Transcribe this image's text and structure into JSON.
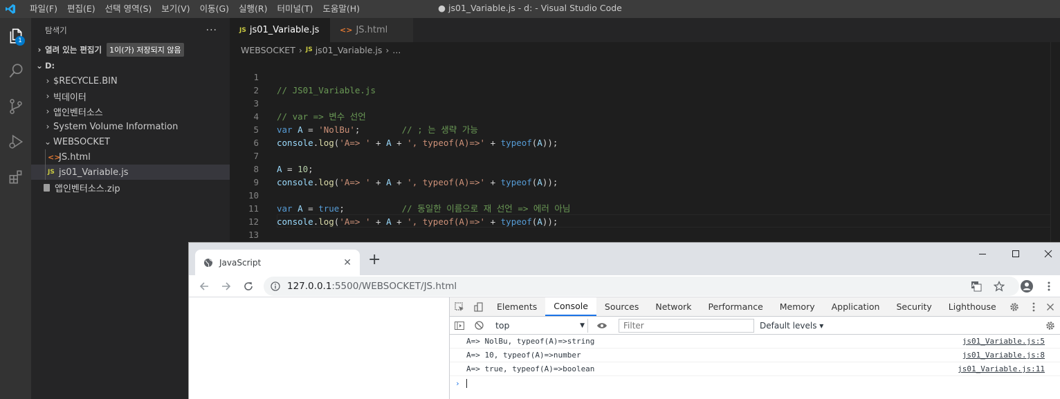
{
  "titlebar": {
    "menu": [
      "파일(F)",
      "편집(E)",
      "선택 영역(S)",
      "보기(V)",
      "이동(G)",
      "실행(R)",
      "터미널(T)",
      "도움말(H)"
    ],
    "window_title": "● js01_Variable.js - d: - Visual Studio Code"
  },
  "activitybar": {
    "badge": "1"
  },
  "sidebar": {
    "title": "탐색기",
    "more": "···",
    "open_editors": "열려 있는 편집기",
    "open_editors_badge": "1이(가) 저장되지 않음",
    "root": "D:",
    "items": [
      {
        "label": "$RECYCLE.BIN"
      },
      {
        "label": "빅데이터"
      },
      {
        "label": "앱인벤터소스"
      },
      {
        "label": "System Volume Information"
      },
      {
        "label": "WEBSOCKET"
      },
      {
        "label": "JS.html"
      },
      {
        "label": "js01_Variable.js"
      },
      {
        "label": "앱인벤터소스.zip"
      }
    ]
  },
  "editor": {
    "tabs": [
      {
        "icon": "JS",
        "label": "js01_Variable.js"
      },
      {
        "icon": "<>",
        "label": "JS.html"
      }
    ],
    "breadcrumb": [
      "WEBSOCKET",
      "js01_Variable.js",
      "..."
    ],
    "line_numbers": [
      "1",
      "2",
      "3",
      "4",
      "5",
      "6",
      "7",
      "8",
      "9",
      "10",
      "11",
      "12",
      "13"
    ]
  },
  "browser": {
    "tab_title": "JavaScript",
    "url_host": "127.0.0.1",
    "url_rest": ":5500/WEBSOCKET/JS.html",
    "devtools": {
      "tabs": [
        "Elements",
        "Console",
        "Sources",
        "Network",
        "Performance",
        "Memory",
        "Application",
        "Security",
        "Lighthouse"
      ],
      "context": "top",
      "filter_placeholder": "Filter",
      "levels": "Default levels ▾",
      "logs": [
        {
          "text": "A=> NolBu, typeof(A)=>string",
          "source": "js01_Variable.js:5"
        },
        {
          "text": "A=> 10, typeof(A)=>number",
          "source": "js01_Variable.js:8"
        },
        {
          "text": "A=> true, typeof(A)=>boolean",
          "source": "js01_Variable.js:11"
        }
      ],
      "prompt": "›"
    }
  },
  "colors": {
    "accent": "#007acc",
    "devtools_active": "#1a73e8"
  }
}
